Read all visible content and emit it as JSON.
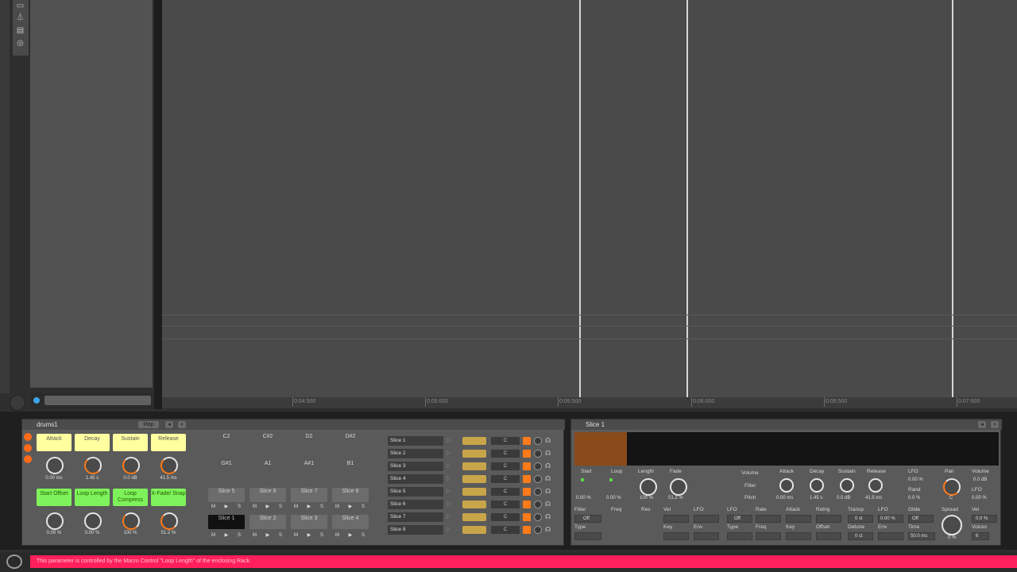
{
  "ruler": {
    "ticks": [
      "0:04:500",
      "0:05:000",
      "0:05:500",
      "0:06:000",
      "0:06:500",
      "0:07:000"
    ]
  },
  "rack": {
    "title": "drums1",
    "map_label": "Map",
    "macros_top": [
      {
        "label": "Attack",
        "value": "0.00 ms"
      },
      {
        "label": "Decay",
        "value": "1.45 s"
      },
      {
        "label": "Sustain",
        "value": "0.0 dB"
      },
      {
        "label": "Release",
        "value": "41.5 ms"
      }
    ],
    "macros_bottom": [
      {
        "label": "Start Offset",
        "value": "0.00 %"
      },
      {
        "label": "Loop Length",
        "value": "0.00 %"
      },
      {
        "label": "Loop Compress",
        "value": "100 %"
      },
      {
        "label": "X-Fade/ Snap",
        "value": "51.2 %"
      }
    ],
    "pad_notes_row1": [
      "C2",
      "C#2",
      "D2",
      "D#2"
    ],
    "pad_notes_row2": [
      "G#1",
      "A1",
      "A#1",
      "B1"
    ],
    "pads_row1": [
      "Slice 5",
      "Slice 6",
      "Slice 7",
      "Slice 8"
    ],
    "pads_row2": [
      "Slice 1",
      "Slice 2",
      "Slice 3",
      "Slice 4"
    ],
    "ms_label": "M ▶ S",
    "chains": [
      {
        "name": "Slice 1",
        "key": "C"
      },
      {
        "name": "Slice 2",
        "key": "C"
      },
      {
        "name": "Slice 3",
        "key": "C"
      },
      {
        "name": "Slice 4",
        "key": "C"
      },
      {
        "name": "Slice 5",
        "key": "C"
      },
      {
        "name": "Slice 6",
        "key": "C"
      },
      {
        "name": "Slice 7",
        "key": "C"
      },
      {
        "name": "Slice 8",
        "key": "C"
      }
    ]
  },
  "simpler": {
    "title": "Slice 1",
    "row1_labels": [
      "Start",
      "Loop",
      "Length",
      "Fade"
    ],
    "row1_values": [
      "0.00 %",
      "0.00 %",
      "100 %",
      "51.2 %"
    ],
    "volume_label": "Volume",
    "filter_label": "Filter",
    "pitch_label": "Pitch",
    "env_labels": [
      "Attack",
      "Decay",
      "Sustain",
      "Release"
    ],
    "env_values": [
      "0.00 ms",
      "1.45 s",
      "0.0 dB",
      "41.5 ms"
    ],
    "lfo_label": "LFO",
    "lfo_value": "0.00 %",
    "rand_label": "Rand",
    "rand_value": "0.0 %",
    "pan_label": "Pan",
    "pan_value": "C",
    "volume2_label": "Volume",
    "volume2_value": "0.0 dB",
    "lfo2_label": "LFO",
    "lfo2_value": "0.00 %",
    "row2_labels": [
      "Filter",
      "Freq",
      "Res",
      "Vel",
      "LFO",
      "LFO",
      "Rate",
      "Attack",
      "Retrig",
      "Transp",
      "LFO",
      "Glide",
      "Spread",
      "Vel"
    ],
    "filter_value": "Off",
    "lfo_off_value": "Off",
    "transp_value": "0 st",
    "lfo3_value": "0.00 %",
    "glide_value": "Off",
    "vel_value": "0.0 %",
    "row3_labels": [
      "Type",
      "Key",
      "Env",
      "Type",
      "Freq",
      "Key",
      "Offset",
      "Detune",
      "Env",
      "Time",
      "Voices"
    ],
    "detune_value": "0 ct",
    "time_value": "50.0 ms",
    "spread_value": "0 %",
    "voices_value": "6"
  },
  "status": {
    "message": "This parameter is controlled by the Macro Control \"Loop Length\" of the enclosing Rack."
  }
}
